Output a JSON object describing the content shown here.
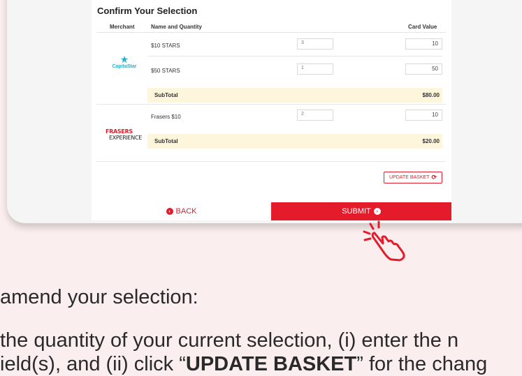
{
  "confirm": {
    "title": "Confirm Your Selection",
    "headers": {
      "merchant": "Merchant",
      "name_qty": "Name and Quantity",
      "card_value": "Card Value"
    },
    "merchants": [
      {
        "logo_text": "CapitaStar",
        "items": [
          {
            "name": "$10 STARS",
            "qty": "3",
            "value": "10"
          },
          {
            "name": "$50 STARS",
            "qty": "1",
            "value": "50"
          }
        ],
        "subtotal_label": "SubTotal",
        "subtotal_amount": "$80.00"
      },
      {
        "logo_text_1": "FRASERS",
        "logo_text_2": "EXPERIENCE",
        "items": [
          {
            "name": "Frasers $10",
            "qty": "2",
            "value": "10"
          }
        ],
        "subtotal_label": "SubTotal",
        "subtotal_amount": "$20.00"
      }
    ],
    "update_label": "UPDATE BASKET",
    "back_label": "BACK",
    "submit_label": "SUBMIT"
  },
  "instructions": {
    "line1": "amend your selection:",
    "line2": "the quantity of your current selection, (i) enter the n",
    "line3_pre": "ield(s), and (ii) click “",
    "line3_bold": "UPDATE BASKET",
    "line3_post": "” for the chang"
  },
  "colors": {
    "accent": "#e31b2a",
    "capitastar": "#2ab0c9",
    "subtotal_bg": "#fdf6dc",
    "page_bg": "#fbeeee"
  }
}
